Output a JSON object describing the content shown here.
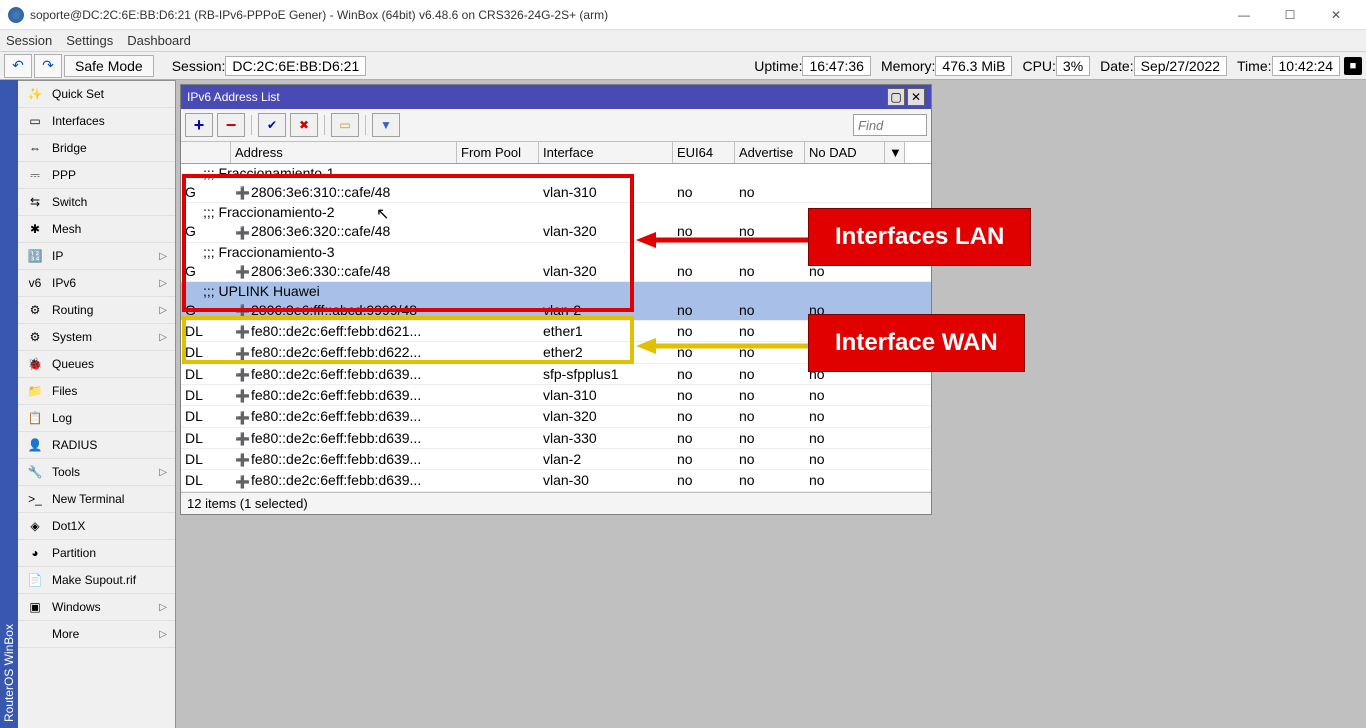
{
  "window": {
    "title": "soporte@DC:2C:6E:BB:D6:21 (RB-IPv6-PPPoE Gener) - WinBox (64bit) v6.48.6 on CRS326-24G-2S+ (arm)"
  },
  "menu": {
    "session": "Session",
    "settings": "Settings",
    "dashboard": "Dashboard"
  },
  "toolbar": {
    "safe_mode": "Safe Mode",
    "session_label": "Session:",
    "session_val": "DC:2C:6E:BB:D6:21",
    "uptime_label": "Uptime:",
    "uptime_val": "16:47:36",
    "memory_label": "Memory:",
    "memory_val": "476.3 MiB",
    "cpu_label": "CPU:",
    "cpu_val": "3%",
    "date_label": "Date:",
    "date_val": "Sep/27/2022",
    "time_label": "Time:",
    "time_val": "10:42:24"
  },
  "vtab": "RouterOS WinBox",
  "sidebar": [
    {
      "label": "Quick Set",
      "arrow": false,
      "icon": "✨"
    },
    {
      "label": "Interfaces",
      "arrow": false,
      "icon": "▭"
    },
    {
      "label": "Bridge",
      "arrow": false,
      "icon": "⇔"
    },
    {
      "label": "PPP",
      "arrow": false,
      "icon": "⎓"
    },
    {
      "label": "Switch",
      "arrow": false,
      "icon": "⇆"
    },
    {
      "label": "Mesh",
      "arrow": false,
      "icon": "✱"
    },
    {
      "label": "IP",
      "arrow": true,
      "icon": "🔢"
    },
    {
      "label": "IPv6",
      "arrow": true,
      "icon": "v6"
    },
    {
      "label": "Routing",
      "arrow": true,
      "icon": "⚙"
    },
    {
      "label": "System",
      "arrow": true,
      "icon": "⚙"
    },
    {
      "label": "Queues",
      "arrow": false,
      "icon": "🐞"
    },
    {
      "label": "Files",
      "arrow": false,
      "icon": "📁"
    },
    {
      "label": "Log",
      "arrow": false,
      "icon": "📋"
    },
    {
      "label": "RADIUS",
      "arrow": false,
      "icon": "👤"
    },
    {
      "label": "Tools",
      "arrow": true,
      "icon": "🔧"
    },
    {
      "label": "New Terminal",
      "arrow": false,
      "icon": ">_"
    },
    {
      "label": "Dot1X",
      "arrow": false,
      "icon": "◈"
    },
    {
      "label": "Partition",
      "arrow": false,
      "icon": "◕"
    },
    {
      "label": "Make Supout.rif",
      "arrow": false,
      "icon": "📄"
    },
    {
      "label": "Windows",
      "arrow": true,
      "icon": "▣"
    },
    {
      "label": "More",
      "arrow": true,
      "icon": ""
    }
  ],
  "panel": {
    "title": "IPv6 Address List",
    "find_placeholder": "Find",
    "headers": {
      "addr": "Address",
      "pool": "From Pool",
      "if": "Interface",
      "eui": "EUI64",
      "adv": "Advertise",
      "dad": "No DAD"
    },
    "footer": "12 items (1 selected)",
    "rows": [
      {
        "comment": ";;; Fraccionamiento-1"
      },
      {
        "flag": "G",
        "addr": "2806:3e6:310::cafe/48",
        "if": "vlan-310",
        "eui": "no",
        "adv": "no"
      },
      {
        "comment": ";;; Fraccionamiento-2"
      },
      {
        "flag": "G",
        "addr": "2806:3e6:320::cafe/48",
        "if": "vlan-320",
        "eui": "no",
        "adv": "no"
      },
      {
        "comment": ";;; Fraccionamiento-3"
      },
      {
        "flag": "G",
        "addr": "2806:3e6:330::cafe/48",
        "if": "vlan-320",
        "eui": "no",
        "adv": "no",
        "dad": "no"
      },
      {
        "comment": ";;; UPLINK Huawei",
        "selected": true
      },
      {
        "flag": "G",
        "addr": "2806:3e6:fff::abcd:9999/48",
        "if": "vlan-2",
        "eui": "no",
        "adv": "no",
        "dad": "no",
        "selected": true
      },
      {
        "flag": "DL",
        "addr": "fe80::de2c:6eff:febb:d621...",
        "if": "ether1",
        "eui": "no",
        "adv": "no",
        "dad": "no"
      },
      {
        "flag": "DL",
        "addr": "fe80::de2c:6eff:febb:d622...",
        "if": "ether2",
        "eui": "no",
        "adv": "no",
        "dad": "no"
      },
      {
        "flag": "DL",
        "addr": "fe80::de2c:6eff:febb:d639...",
        "if": "sfp-sfpplus1",
        "eui": "no",
        "adv": "no",
        "dad": "no"
      },
      {
        "flag": "DL",
        "addr": "fe80::de2c:6eff:febb:d639...",
        "if": "vlan-310",
        "eui": "no",
        "adv": "no",
        "dad": "no"
      },
      {
        "flag": "DL",
        "addr": "fe80::de2c:6eff:febb:d639...",
        "if": "vlan-320",
        "eui": "no",
        "adv": "no",
        "dad": "no"
      },
      {
        "flag": "DL",
        "addr": "fe80::de2c:6eff:febb:d639...",
        "if": "vlan-330",
        "eui": "no",
        "adv": "no",
        "dad": "no"
      },
      {
        "flag": "DL",
        "addr": "fe80::de2c:6eff:febb:d639...",
        "if": "vlan-2",
        "eui": "no",
        "adv": "no",
        "dad": "no"
      },
      {
        "flag": "DL",
        "addr": "fe80::de2c:6eff:febb:d639...",
        "if": "vlan-30",
        "eui": "no",
        "adv": "no",
        "dad": "no"
      }
    ]
  },
  "annotations": {
    "lan": "Interfaces LAN",
    "wan": "Interface WAN"
  }
}
